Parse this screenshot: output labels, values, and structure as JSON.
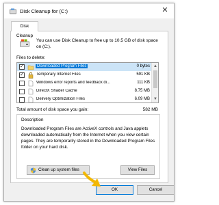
{
  "window": {
    "title": "Disk Cleanup for  (C:)",
    "close_glyph": "✕"
  },
  "tabs": [
    {
      "label": "Disk Cleanup"
    }
  ],
  "intro_text": "You can use Disk Cleanup to free up to 10.5 GB of disk space on  (C:).",
  "files": {
    "label": "Files to delete:",
    "items": [
      {
        "name": "Downloaded Program Files",
        "size": "0 bytes",
        "checked": true,
        "selected": true,
        "icon": "folder-icon"
      },
      {
        "name": "Temporary Internet Files",
        "size": "591 KB",
        "checked": true,
        "selected": false,
        "icon": "lock-icon"
      },
      {
        "name": "Windows error reports and feedback di...",
        "size": "111 KB",
        "checked": false,
        "selected": false,
        "icon": "file-icon"
      },
      {
        "name": "DirectX Shader Cache",
        "size": "8.75 MB",
        "checked": false,
        "selected": false,
        "icon": "file-icon"
      },
      {
        "name": "Delivery Optimization Files",
        "size": "6.09 MB",
        "checked": false,
        "selected": false,
        "icon": "file-icon"
      }
    ]
  },
  "total": {
    "label": "Total amount of disk space you gain:",
    "value": "582 MB"
  },
  "description": {
    "title": "Description",
    "text": "Downloaded Program Files are ActiveX controls and Java applets downloaded automatically from the Internet when you view certain pages. They are temporarily stored in the Downloaded Program Files folder on your hard disk."
  },
  "buttons": {
    "cleanup_system": "Clean up system files",
    "view_files": "View Files",
    "ok": "OK",
    "cancel": "Cancel"
  },
  "colors": {
    "selection": "#0078d7",
    "arrow": "#f2b705"
  }
}
